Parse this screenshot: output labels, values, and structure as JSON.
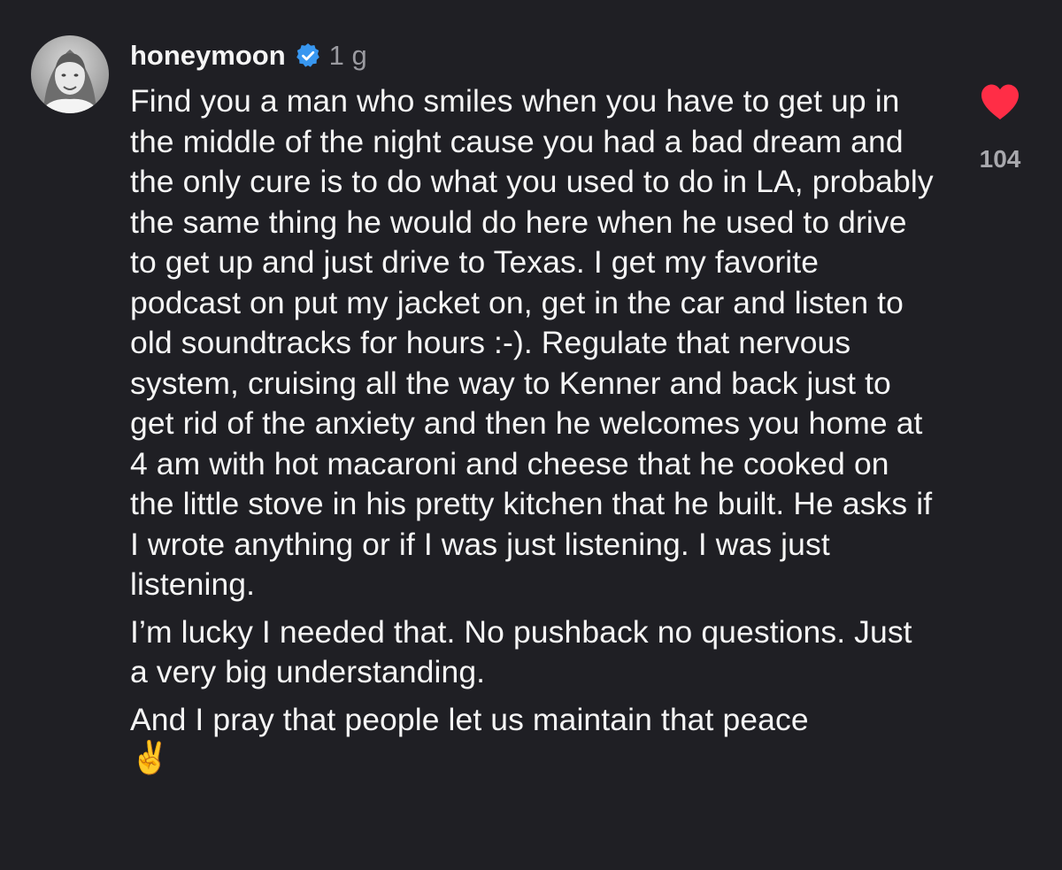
{
  "comment": {
    "username": "honeymoon",
    "verified_icon": "verified-badge-icon",
    "timestamp": "1 g",
    "paragraphs": [
      "Find you a man who smiles when you have to get up in the middle of the night cause you had a bad dream and the only cure is to do what you used to do in LA, probably the same thing he would do here when he used to drive to get up and just drive to Texas. I get my favorite podcast on put my jacket on, get in the car and listen to old soundtracks for hours :-). Regulate that nervous system, cruising  all the way to Kenner and back just to get rid of the anxiety and then he welcomes you home at 4 am with hot macaroni and cheese that he cooked on the little stove in his pretty kitchen that he built. He asks if I wrote anything or if I was just listening. I was just listening.",
      "I’m lucky I needed that. No pushback no questions. Just a very big understanding.",
      "And I pray that people let us maintain that peace"
    ],
    "emoji": "✌️",
    "like_count": "104",
    "like_icon": "heart-icon",
    "colors": {
      "background": "#1f1f24",
      "text": "#f5f5f5",
      "muted": "#9a9aa0",
      "heart": "#ff2d46",
      "verified": "#3897f0"
    }
  }
}
